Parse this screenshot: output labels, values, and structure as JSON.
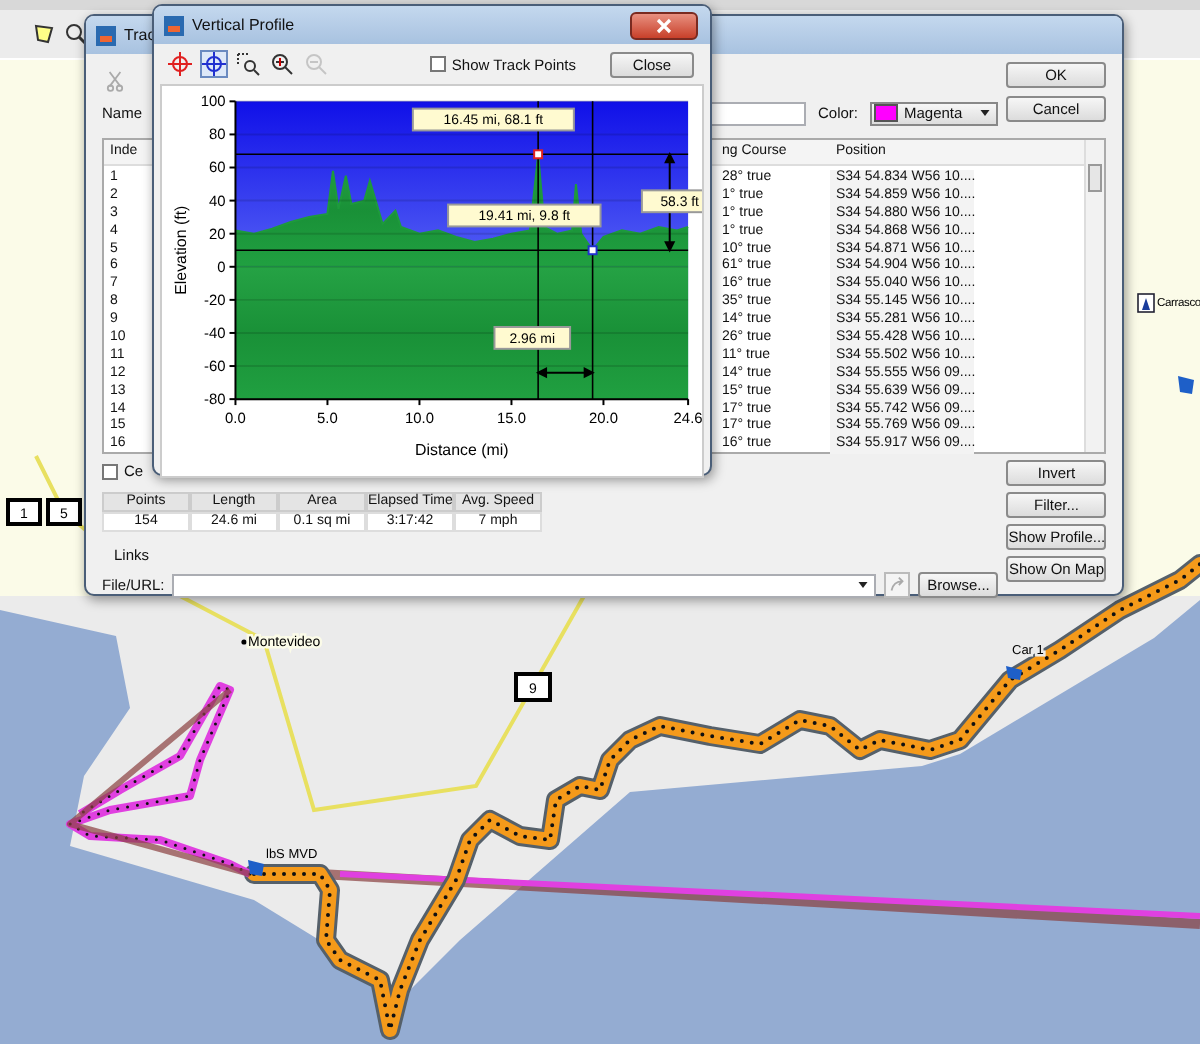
{
  "map": {
    "places": [
      {
        "label": "Montevideo"
      },
      {
        "label": "Carrasco"
      }
    ],
    "road_shields": [
      "1",
      "5",
      "9"
    ],
    "waypoints": [
      {
        "label": "lbS MVD"
      },
      {
        "label": "Car 1"
      }
    ]
  },
  "track_dialog": {
    "title": "Trac",
    "name_label": "Name",
    "color_label": "Color:",
    "color_field": {
      "value": "Magenta",
      "color": "#ff00ff"
    },
    "top_buttons": [
      "OK",
      "Cancel"
    ],
    "table": {
      "columns": [
        "Inde",
        "ng Course",
        "Position"
      ],
      "rows": [
        {
          "index": "1",
          "course": "28° true",
          "position": "S34 54.834 W56 10...."
        },
        {
          "index": "2",
          "course": "1° true",
          "position": "S34 54.859 W56 10...."
        },
        {
          "index": "3",
          "course": "1° true",
          "position": "S34 54.880 W56 10...."
        },
        {
          "index": "4",
          "course": "1° true",
          "position": "S34 54.868 W56 10...."
        },
        {
          "index": "5",
          "course": "10° true",
          "position": "S34 54.871 W56 10...."
        },
        {
          "index": "6",
          "course": "61° true",
          "position": "S34 54.904 W56 10...."
        },
        {
          "index": "7",
          "course": "16° true",
          "position": "S34 55.040 W56 10...."
        },
        {
          "index": "8",
          "course": "35° true",
          "position": "S34 55.145 W56 10...."
        },
        {
          "index": "9",
          "course": "14° true",
          "position": "S34 55.281 W56 10...."
        },
        {
          "index": "10",
          "course": "26° true",
          "position": "S34 55.428 W56 10...."
        },
        {
          "index": "11",
          "course": "11° true",
          "position": "S34 55.502 W56 10...."
        },
        {
          "index": "12",
          "course": "14° true",
          "position": "S34 55.555 W56 09...."
        },
        {
          "index": "13",
          "course": "15° true",
          "position": "S34 55.639 W56 09...."
        },
        {
          "index": "14",
          "course": "17° true",
          "position": "S34 55.742 W56 09...."
        },
        {
          "index": "15",
          "course": "17° true",
          "position": "S34 55.769 W56 09...."
        },
        {
          "index": "16",
          "course": "16° true",
          "position": "S34 55.917 W56 09...."
        }
      ]
    },
    "checkbox": {
      "label": "Ce",
      "checked": false
    },
    "stats": {
      "columns": [
        "Points",
        "Length",
        "Area",
        "Elapsed Time",
        "Avg. Speed"
      ],
      "values": [
        "154",
        "24.6 mi",
        "0.1 sq mi",
        "3:17:42",
        "7 mph"
      ]
    },
    "links_label": "Links",
    "file_label": "File/URL:",
    "browse_button": "Browse...",
    "side_buttons": [
      "Invert",
      "Filter...",
      "Show Profile...",
      "Show On Map"
    ]
  },
  "profile_window": {
    "title": "Vertical Profile",
    "tools": [
      {
        "kind": "select",
        "selected": false,
        "disabled": false
      },
      {
        "kind": "measure",
        "selected": true,
        "disabled": false
      },
      {
        "kind": "zoombox",
        "selected": false,
        "disabled": false
      },
      {
        "kind": "zoomin",
        "selected": false,
        "disabled": false
      },
      {
        "kind": "zoomout",
        "selected": false,
        "disabled": true
      }
    ],
    "show_track_points": {
      "label": "Show Track Points",
      "checked": false
    },
    "close_button": "Close",
    "chart_data": {
      "type": "area",
      "xlabel": "Distance  (mi)",
      "ylabel": "Elevation (ft)",
      "x": [
        0,
        1,
        2,
        3,
        4,
        5,
        5.3,
        5.6,
        6,
        6.3,
        7,
        7.3,
        8,
        8.7,
        9,
        10,
        11,
        12,
        13,
        14,
        15,
        16,
        16.45,
        16.8,
        17.5,
        18.3,
        18.5,
        18.8,
        19.41,
        20,
        21,
        22,
        23,
        24,
        24.6
      ],
      "series": [
        {
          "color": "#1e9a3c",
          "values": [
            22,
            20,
            23,
            27,
            30,
            32,
            58,
            35,
            55,
            38,
            40,
            52,
            26,
            34,
            24,
            20,
            22,
            18,
            15,
            17,
            20,
            22,
            68,
            24,
            20,
            22,
            50,
            20,
            10,
            18,
            22,
            20,
            24,
            22,
            24
          ]
        }
      ],
      "grid": true,
      "bands": [
        {
          "axis": "y",
          "from": -80,
          "to": 0
        }
      ],
      "xlim": [
        0,
        24.6
      ],
      "ylim": [
        -80,
        100
      ],
      "xticks": [
        {
          "value": 0,
          "label": "0.0"
        },
        {
          "value": 5,
          "label": "5.0"
        },
        {
          "value": 10,
          "label": "10.0"
        },
        {
          "value": 15,
          "label": "15.0"
        },
        {
          "value": 20,
          "label": "20.0"
        },
        {
          "value": 24.6,
          "label": "24.6"
        }
      ],
      "yticks": [
        -80,
        -60,
        -40,
        -20,
        0,
        20,
        40,
        60,
        80,
        100
      ],
      "annotations": [
        {
          "text": "16.45 mi, 68.1 ft"
        },
        {
          "text": "19.41 mi, 9.8 ft"
        },
        {
          "text": "58.3 ft"
        },
        {
          "text": "2.96 mi"
        }
      ]
    }
  }
}
